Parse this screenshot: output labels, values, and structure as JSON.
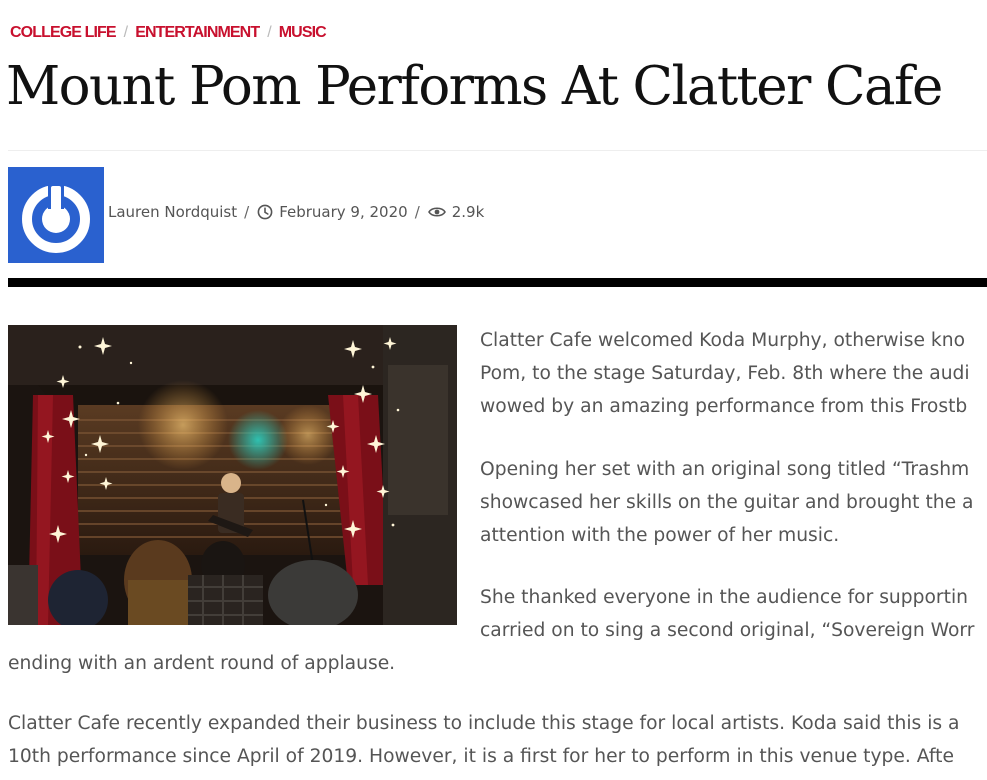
{
  "breadcrumb": {
    "items": [
      "COLLEGE LIFE",
      "ENTERTAINMENT",
      "MUSIC"
    ],
    "separator": "/"
  },
  "article": {
    "title": "Mount Pom Performs At Clatter Cafe",
    "author": "Lauren Nordquist",
    "date": "February 9, 2020",
    "views": "2.9k",
    "meta_separator": "/"
  },
  "body": {
    "p1": [
      "Clatter Cafe welcomed Koda Murphy, otherwise kno",
      "Pom, to the stage Saturday, Feb. 8th where the audi",
      "wowed by an amazing performance from this Frostb"
    ],
    "p2": [
      "Opening her set with an original song titled “Trashm",
      "showcased her skills on the guitar and brought the a",
      "attention with the power of her music."
    ],
    "p3": [
      "She thanked everyone in the audience for supportin",
      "carried on to sing a second original, “Sovereign Worr",
      "ending with an ardent round of applause."
    ],
    "p4": [
      "Clatter Cafe recently expanded their business to include this stage for local artists. Koda said this is a",
      "10th performance since April of 2019. However, it is a first for her to perform in this venue type. Afte"
    ]
  },
  "icons": {
    "author_avatar": "power-logo-icon",
    "date": "clock-icon",
    "views": "eye-icon"
  },
  "colors": {
    "category": "#c8102e",
    "avatar_bg": "#2a61cf",
    "divider": "#000000",
    "body_text": "#555555",
    "title_text": "#111111"
  }
}
